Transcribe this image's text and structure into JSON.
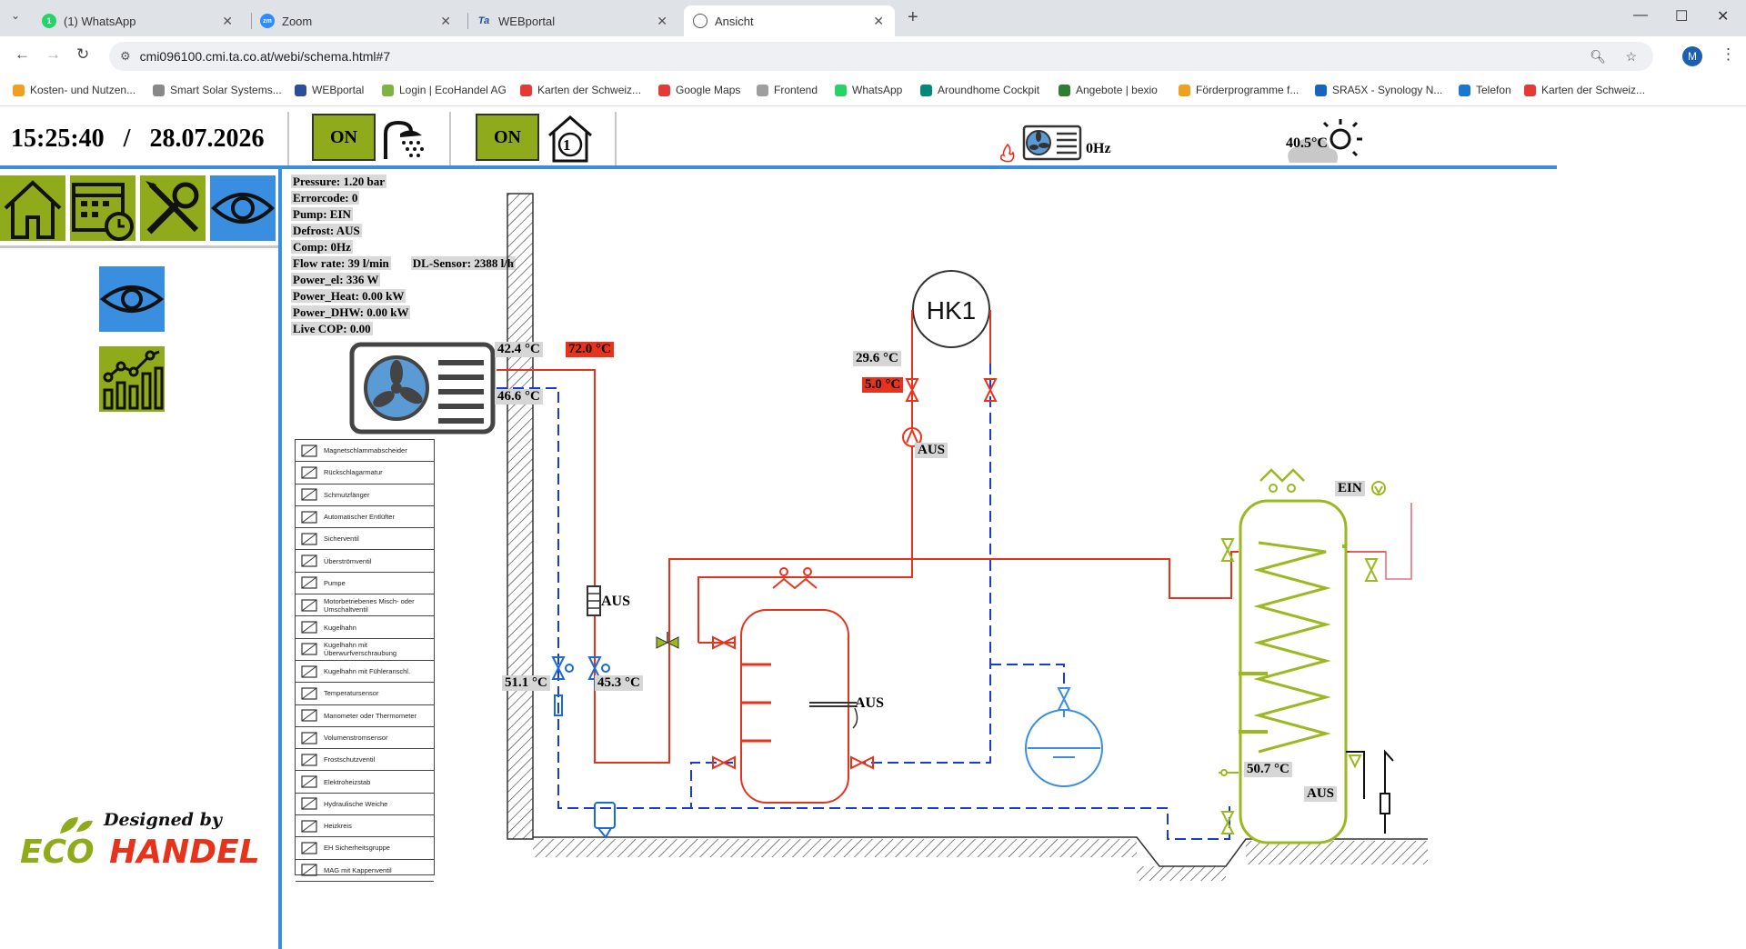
{
  "browser": {
    "tabs": [
      {
        "label": "(1) WhatsApp",
        "icon": "whatsapp-icon"
      },
      {
        "label": "Zoom",
        "icon": "zoom-icon"
      },
      {
        "label": "WEBportal",
        "icon": "ta-icon"
      },
      {
        "label": "Ansicht",
        "icon": "globe-icon",
        "active": true
      }
    ],
    "url": "cmi096100.cmi.ta.co.at/webi/schema.html#7",
    "profile_initial": "M",
    "bookmarks": [
      {
        "label": "Kosten- und Nutzen...",
        "color": "#f0a020"
      },
      {
        "label": "Smart Solar Systems...",
        "color": "#888888"
      },
      {
        "label": "WEBportal",
        "color": "#2a4e9c"
      },
      {
        "label": "Login | EcoHandel AG",
        "color": "#7cb342"
      },
      {
        "label": "Karten der Schweiz...",
        "color": "#e53935"
      },
      {
        "label": "Google Maps",
        "color": "#e53935"
      },
      {
        "label": "Frontend",
        "color": "#9e9e9e"
      },
      {
        "label": "WhatsApp",
        "color": "#25d366"
      },
      {
        "label": "Aroundhome Cockpit",
        "color": "#00897b"
      },
      {
        "label": "Angebote | bexio",
        "color": "#2e7d32"
      },
      {
        "label": "Förderprogramme f...",
        "color": "#f0a020"
      },
      {
        "label": "SRA5X - Synology N...",
        "color": "#1565c0"
      },
      {
        "label": "Telefon",
        "color": "#1976d2"
      },
      {
        "label": "Karten der Schweiz...",
        "color": "#e53935"
      }
    ]
  },
  "header": {
    "time": "15:25:40",
    "separator": "/",
    "date": "28.07.2026",
    "dhw_button": "ON",
    "hk1_button": "ON",
    "hk1_house_number": "1",
    "compressor_freq": "0Hz",
    "outdoor_temp": "40.5°C"
  },
  "info": {
    "pressure": "Pressure: 1.20 bar",
    "errorcode": "Errorcode: 0",
    "pump": "Pump: EIN",
    "defrost": "Defrost: AUS",
    "comp": "Comp: 0Hz",
    "flow_rate": "Flow rate: 39 l/min",
    "dl_sensor": "DL-Sensor: 2388 l/h",
    "power_el": "Power_el: 336 W",
    "power_heat": "Power_Heat: 0.00 kW",
    "power_dhw": "Power_DHW: 0.00 kW",
    "live_cop": "Live COP: 0.00"
  },
  "schema": {
    "hp_supply_temp": "42.4 °C",
    "hp_return_temp": "46.6 °C",
    "hp_setpoint_temp": "72.0 °C",
    "hk1_label": "HK1",
    "hk1_temp": "29.6 °C",
    "hk1_setpoint": "5.0 °C",
    "hk1_pump_state": "AUS",
    "heater_state": "AUS",
    "temp_left": "51.1 °C",
    "temp_right": "45.3 °C",
    "buffer_heater_state": "AUS",
    "dhw_pump_state": "EIN",
    "dhw_temp": "50.7 °C",
    "dhw_heater_state": "AUS"
  },
  "legend": [
    "Magnetschlammabscheider",
    "Rückschlagarmatur",
    "Schmutzfänger",
    "Automatischer Entlüfter",
    "Sicherventil",
    "Überströmventil",
    "Pumpe",
    "Motorbetriebenes Misch- oder Umschaltventil",
    "Kugelhahn",
    "Kugelhahn mit Überwurfverschraubung",
    "Kugelhahn mit Fühleranschl.",
    "Temperatursensor",
    "Manometer oder Thermometer",
    "Volumenstromsensor",
    "Frostschutzventil",
    "Elektroheizstab",
    "Hydraulische Weiche",
    "Heizkreis",
    "EH Sicherheitsgruppe",
    "MAG mit Kappenventil"
  ],
  "logo": {
    "tagline": "Designed by",
    "word1": "ECO",
    "word2": "HANDEL"
  },
  "colors": {
    "on_button": "#8fab1c",
    "accent_blue": "#3a8ee0",
    "supply_red": "#e8331c",
    "return_blue": "#1a3ad6",
    "dhw_green": "#9ab81f"
  }
}
